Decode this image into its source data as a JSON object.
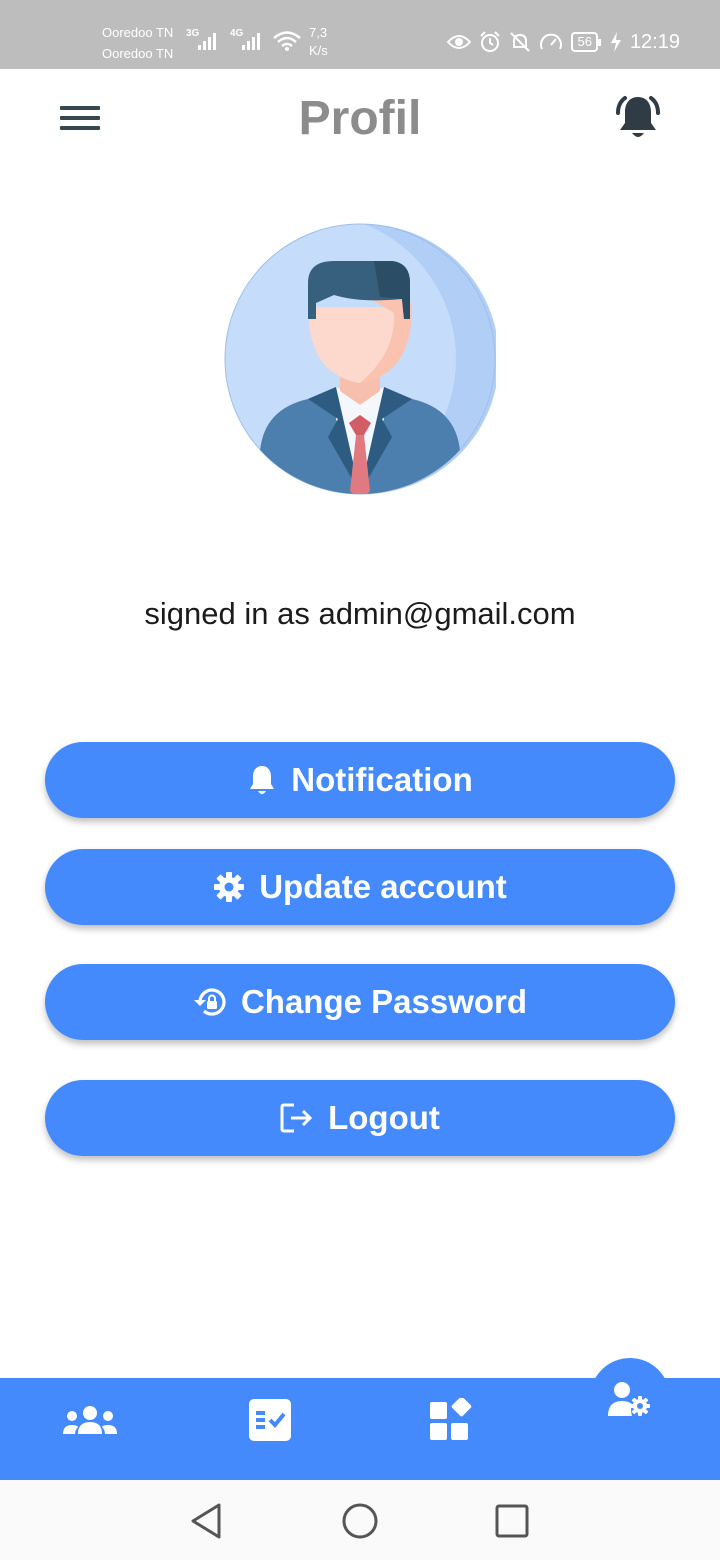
{
  "status_bar": {
    "carrier_1": "Ooredoo TN",
    "carrier_2": "Ooredoo TN",
    "net_1": "3G",
    "net_2": "4G",
    "speed_value": "7,3",
    "speed_unit": "K/s",
    "battery": "56",
    "time": "12:19"
  },
  "app_bar": {
    "title": "Profil",
    "menu_icon": "hamburger-menu-icon",
    "notification_icon": "bell-ringing-icon"
  },
  "profile": {
    "signed_in_text": "signed in as admin@gmail.com"
  },
  "actions": [
    {
      "label": "Notification",
      "icon": "bell-icon"
    },
    {
      "label": "Update account",
      "icon": "gear-icon"
    },
    {
      "label": "Change Password",
      "icon": "lock-reset-icon"
    },
    {
      "label": "Logout",
      "icon": "logout-icon"
    }
  ],
  "bottom_nav": {
    "items": [
      "users-icon",
      "task-list-icon",
      "widgets-icon",
      "user-settings-icon"
    ],
    "active_index": 3
  },
  "colors": {
    "primary": "#448afc",
    "title": "#8c8c8c",
    "status_bar": "#bdbdbd"
  }
}
